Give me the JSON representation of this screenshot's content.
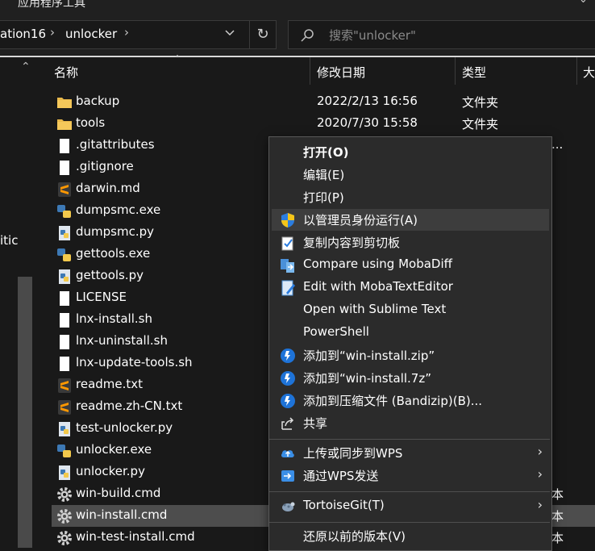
{
  "window": {
    "ribbon_title": "应用程序工具"
  },
  "address": {
    "crumbs": [
      "ation16",
      "unlocker"
    ],
    "search_placeholder": "搜索\"unlocker\""
  },
  "nav": {
    "partial_label": "itic"
  },
  "columns": {
    "name": "名称",
    "date": "修改日期",
    "type": "类型",
    "size": "大"
  },
  "files": [
    {
      "name": "backup",
      "date": "2022/2/13 16:56",
      "type": "文件夹",
      "extra": "",
      "icon": "folder-icon"
    },
    {
      "name": "tools",
      "date": "2020/7/30 15:58",
      "type": "文件夹",
      "extra": "",
      "icon": "folder-icon"
    },
    {
      "name": ".gitattributes",
      "date": "",
      "type": "",
      "extra": "...",
      "icon": "file-icon"
    },
    {
      "name": ".gitignore",
      "date": "",
      "type": "",
      "extra": "",
      "icon": "file-icon"
    },
    {
      "name": "darwin.md",
      "date": "",
      "type": "",
      "extra": "",
      "icon": "sublime-icon"
    },
    {
      "name": "dumpsmc.exe",
      "date": "",
      "type": "",
      "extra": "",
      "icon": "python-exe-icon"
    },
    {
      "name": "dumpsmc.py",
      "date": "",
      "type": "",
      "extra": "",
      "icon": "python-icon"
    },
    {
      "name": "gettools.exe",
      "date": "",
      "type": "",
      "extra": "",
      "icon": "python-exe-icon"
    },
    {
      "name": "gettools.py",
      "date": "",
      "type": "",
      "extra": "",
      "icon": "python-icon"
    },
    {
      "name": "LICENSE",
      "date": "",
      "type": "",
      "extra": "",
      "icon": "file-icon"
    },
    {
      "name": "lnx-install.sh",
      "date": "",
      "type": "",
      "extra": "",
      "icon": "file-icon"
    },
    {
      "name": "lnx-uninstall.sh",
      "date": "",
      "type": "",
      "extra": "",
      "icon": "file-icon"
    },
    {
      "name": "lnx-update-tools.sh",
      "date": "",
      "type": "",
      "extra": "",
      "icon": "file-icon"
    },
    {
      "name": "readme.txt",
      "date": "",
      "type": "",
      "extra": "",
      "icon": "sublime-icon"
    },
    {
      "name": "readme.zh-CN.txt",
      "date": "",
      "type": "",
      "extra": "",
      "icon": "sublime-icon"
    },
    {
      "name": "test-unlocker.py",
      "date": "",
      "type": "",
      "extra": "",
      "icon": "python-icon"
    },
    {
      "name": "unlocker.exe",
      "date": "",
      "type": "",
      "extra": "",
      "icon": "python-exe-icon"
    },
    {
      "name": "unlocker.py",
      "date": "",
      "type": "",
      "extra": "",
      "icon": "python-icon"
    },
    {
      "name": "win-build.cmd",
      "date": "",
      "type": "",
      "extra": "本",
      "icon": "gear-icon"
    },
    {
      "name": "win-install.cmd",
      "date": "",
      "type": "",
      "extra": "本",
      "icon": "gear-icon",
      "selected": true
    },
    {
      "name": "win-test-install.cmd",
      "date": "",
      "type": "",
      "extra": "本",
      "icon": "gear-icon"
    }
  ],
  "menu": [
    {
      "label": "打开(O)",
      "bold": true,
      "icon": ""
    },
    {
      "label": "编辑(E)",
      "icon": ""
    },
    {
      "label": "打印(P)",
      "icon": ""
    },
    {
      "label": "以管理员身份运行(A)",
      "icon": "uac-shield-icon",
      "highlight": true
    },
    {
      "label": "复制内容到剪切板",
      "icon": "clipboard-icon"
    },
    {
      "label": "Compare using MobaDiff",
      "icon": "mobadiff-icon"
    },
    {
      "label": "Edit with MobaTextEditor",
      "icon": "mobatexteditor-icon"
    },
    {
      "label": "Open with Sublime Text",
      "icon": ""
    },
    {
      "label": "PowerShell",
      "icon": ""
    },
    {
      "label": "添加到“win-install.zip”",
      "icon": "bandizip-icon"
    },
    {
      "label": "添加到“win-install.7z”",
      "icon": "bandizip-icon"
    },
    {
      "label": "添加到压缩文件 (Bandizip)(B)...",
      "icon": "bandizip-icon"
    },
    {
      "label": "共享",
      "icon": "share-icon"
    },
    {
      "label": "上传或同步到WPS",
      "icon": "cloud-upload-icon",
      "submenu": true
    },
    {
      "label": "通过WPS发送",
      "icon": "wps-send-icon",
      "submenu": true
    },
    {
      "label": "TortoiseGit(T)",
      "icon": "tortoisegit-icon",
      "submenu": true
    },
    {
      "label": "还原以前的版本(V)",
      "icon": ""
    }
  ],
  "colors": {
    "background": "#191919",
    "menu_bg": "#2b2b2b",
    "selection": "#4d4d4d",
    "folder": "#e8b84b",
    "accent_blue": "#2b7de0"
  }
}
